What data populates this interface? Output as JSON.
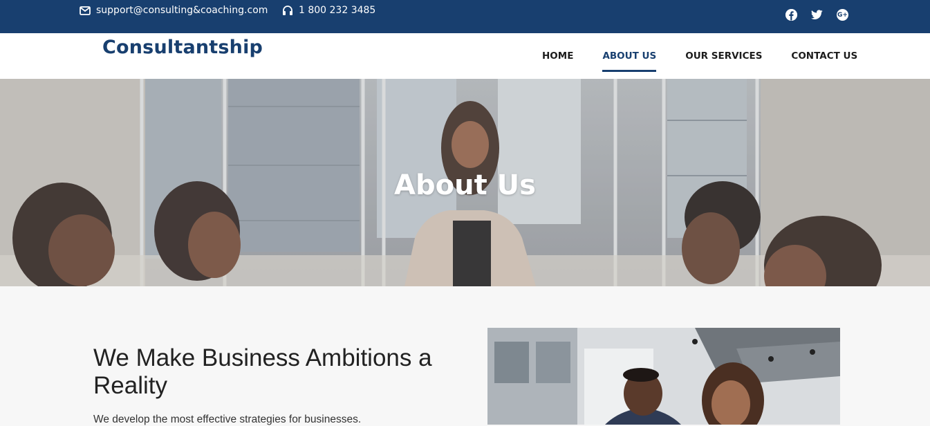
{
  "topbar": {
    "email": "support@consulting&coaching.com",
    "phone": "1 800 232 3485",
    "social": [
      {
        "name": "facebook-icon"
      },
      {
        "name": "twitter-icon"
      },
      {
        "name": "google-plus-icon"
      }
    ]
  },
  "navbar": {
    "brand": "Consultantship",
    "items": [
      {
        "label": "HOME",
        "active": false
      },
      {
        "label": "ABOUT US",
        "active": true
      },
      {
        "label": "OUR SERVICES",
        "active": false
      },
      {
        "label": "CONTACT US",
        "active": false
      }
    ]
  },
  "hero": {
    "title": "About Us"
  },
  "content": {
    "headline": "We Make Business Ambitions a Reality",
    "paragraph": "We develop the most effective strategies for businesses."
  },
  "colors": {
    "primary": "#183f6f",
    "background": "#f7f7f7"
  }
}
